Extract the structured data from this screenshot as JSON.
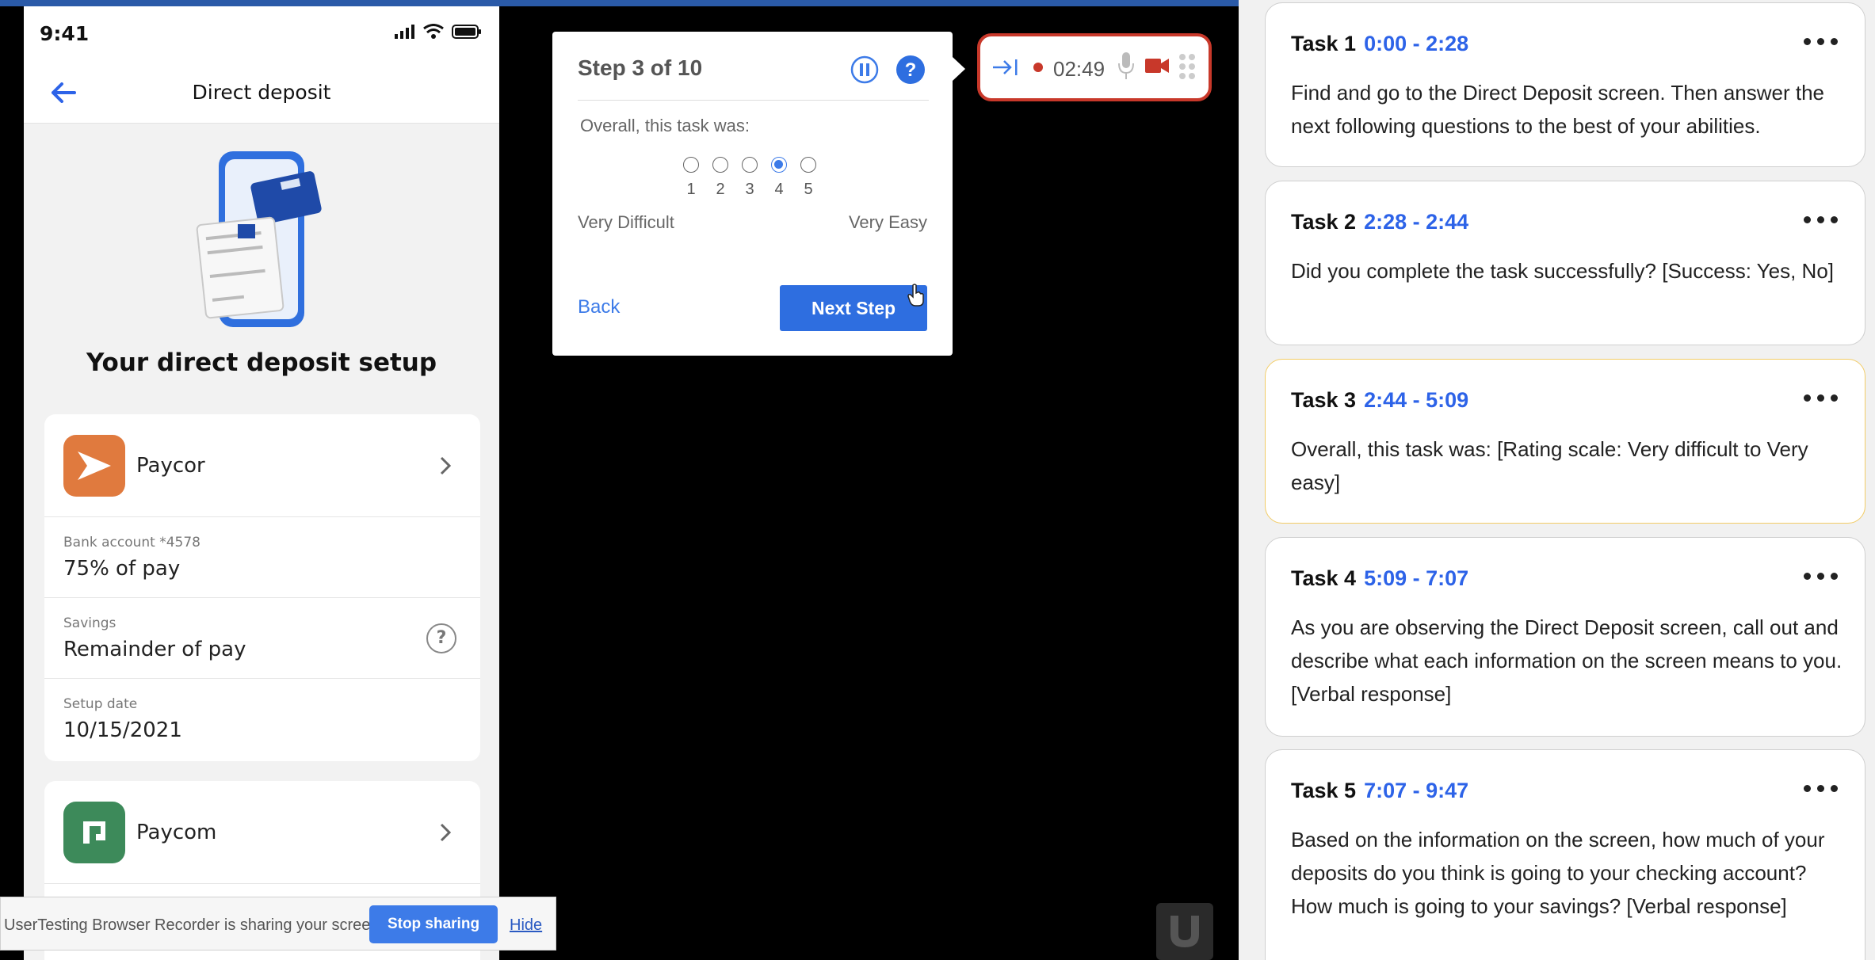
{
  "phone": {
    "time": "9:41",
    "nav_title": "Direct deposit",
    "setup_title": "Your direct deposit setup",
    "employers": [
      {
        "name": "Paycor",
        "color": "#e07a3e",
        "fields": [
          {
            "label": "Bank account *4578",
            "value": "75% of pay"
          },
          {
            "label": "Savings",
            "value": "Remainder of pay"
          },
          {
            "label": "Setup date",
            "value": "10/15/2021"
          }
        ]
      },
      {
        "name": "Paycom",
        "color": "#3d8a5a"
      }
    ]
  },
  "share_bar": {
    "message": "UserTesting Browser Recorder is sharing your screen.",
    "stop_label": "Stop sharing",
    "hide_label": "Hide"
  },
  "step_dialog": {
    "title": "Step 3 of 10",
    "question": "Overall, this task was:",
    "scale": [
      "1",
      "2",
      "3",
      "4",
      "5"
    ],
    "selected": 4,
    "low_label": "Very Difficult",
    "high_label": "Very Easy",
    "back_label": "Back",
    "next_label": "Next Step"
  },
  "recorder": {
    "timer": "02:49",
    "record_color": "#c8382a"
  },
  "tasks": [
    {
      "name": "Task 1",
      "range": "0:00 - 2:28",
      "text": "Find and go to the Direct Deposit screen. Then answer the next following questions to the best of your abilities."
    },
    {
      "name": "Task 2",
      "range": "2:28 - 2:44",
      "text": "Did you complete the task successfully? [Success: Yes, No]"
    },
    {
      "name": "Task 3",
      "range": "2:44 - 5:09",
      "text": "Overall, this task was: [Rating scale: Very difficult to Very easy]"
    },
    {
      "name": "Task 4",
      "range": "5:09 - 7:07",
      "text": "As you are observing the Direct Deposit screen, call out and describe what each information on the screen means to you. [Verbal response]"
    },
    {
      "name": "Task 5",
      "range": "7:07 - 9:47",
      "text": "Based on the information on the screen, how much of your deposits do you think is going to your checking account? How much is going to your savings? [Verbal response]"
    }
  ]
}
